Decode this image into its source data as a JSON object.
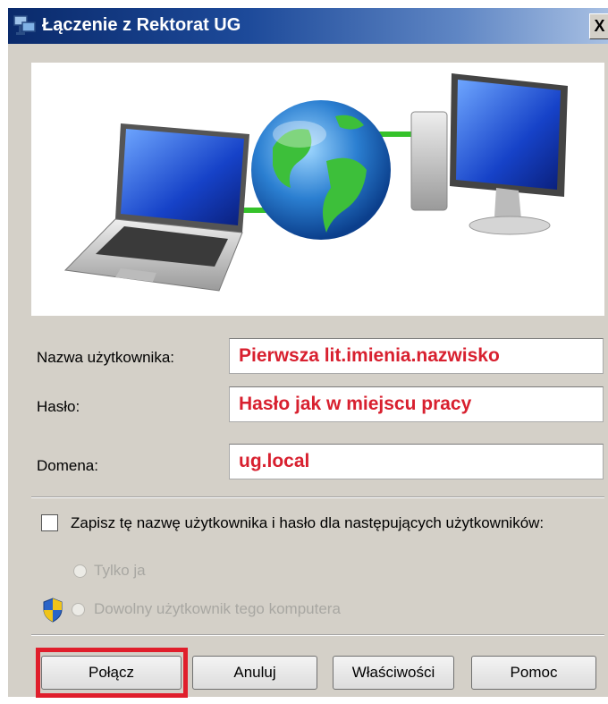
{
  "window": {
    "title": "Łączenie z Rektorat UG",
    "close_label": "X"
  },
  "fields": {
    "username": {
      "label": "Nazwa użytkownika:",
      "value": "Pierwsza lit.imienia.nazwisko"
    },
    "password": {
      "label": "Hasło:",
      "value": "Hasło jak w miejscu pracy"
    },
    "domain": {
      "label": "Domena:",
      "value": "ug.local"
    }
  },
  "save_credentials": {
    "label": "Zapisz tę nazwę użytkownika i hasło dla następujących użytkowników:",
    "checked": false,
    "options": [
      {
        "label": "Tylko ja",
        "enabled": false
      },
      {
        "label": "Dowolny użytkownik tego komputera",
        "enabled": false
      }
    ]
  },
  "buttons": {
    "connect": "Połącz",
    "cancel": "Anuluj",
    "properties": "Właściwości",
    "help": "Pomoc"
  },
  "colors": {
    "field_text": "#d8202f",
    "highlight": "#e01e2b"
  },
  "icons": [
    "network-connection-icon",
    "uac-shield-icon",
    "laptop-icon",
    "globe-icon",
    "desktop-computer-icon"
  ]
}
